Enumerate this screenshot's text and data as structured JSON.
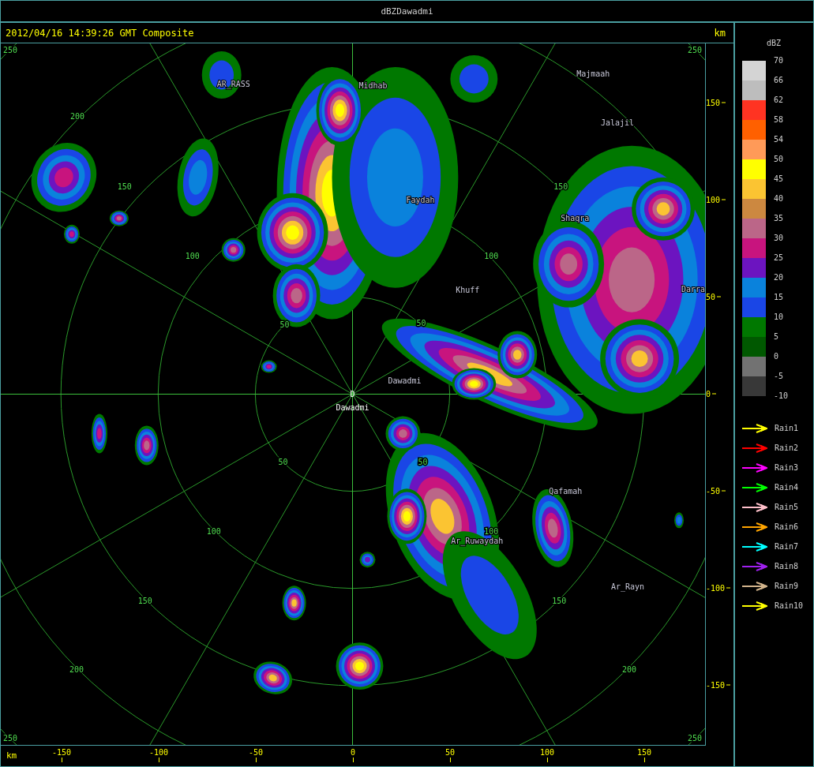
{
  "window": {
    "title": "dBZDawadmi"
  },
  "header": {
    "timestamp": "2012/04/16 14:39:26 GMT Composite",
    "unit": "km"
  },
  "map": {
    "site": {
      "marker": "D",
      "name": "Dawadmi"
    },
    "ring_labels": [
      "250",
      "250",
      "250",
      "250",
      "200",
      "150",
      "100",
      "50",
      "50",
      "100",
      "150",
      "50",
      "50",
      "100",
      "100",
      "150",
      "150",
      "200",
      "200"
    ],
    "places": [
      "AR_RASS",
      "Midhab",
      "Majmaah",
      "Jalajil",
      "Faydah",
      "Shaqra",
      "Khuff",
      "Darra",
      "Dawadmi",
      "Qafamah",
      "Ar_Ruwaydah",
      "Ar_Rayn"
    ]
  },
  "y_axis": {
    "ticks": [
      "150",
      "100",
      "50",
      "0",
      "-50",
      "-100",
      "-150"
    ]
  },
  "x_axis": {
    "unit": "km",
    "ticks": [
      "-150",
      "-100",
      "-50",
      "0",
      "50",
      "100",
      "150"
    ]
  },
  "legend": {
    "title": "dBZ",
    "labels": [
      "70",
      "66",
      "62",
      "58",
      "54",
      "50",
      "45",
      "40",
      "35",
      "30",
      "25",
      "20",
      "15",
      "10",
      "5",
      "0",
      "-5",
      "-10"
    ],
    "bands": [
      {
        "color": "#d4d4d4"
      },
      {
        "color": "#bdbdbd"
      },
      {
        "color": "#ff3322"
      },
      {
        "color": "#ff6000"
      },
      {
        "color": "#ff9a58"
      },
      {
        "color": "#ffff00"
      },
      {
        "color": "#fbc432"
      },
      {
        "color": "#cc8840"
      },
      {
        "color": "#bb6688"
      },
      {
        "color": "#c8147e"
      },
      {
        "color": "#6c14c0"
      },
      {
        "color": "#0a82dc"
      },
      {
        "color": "#1a46e6"
      },
      {
        "color": "#007800"
      },
      {
        "color": "#005800"
      },
      {
        "color": "#727272"
      },
      {
        "color": "#383838"
      }
    ]
  },
  "tracks": [
    {
      "label": "Rain1",
      "color": "#ffff00"
    },
    {
      "label": "Rain2",
      "color": "#ff0000"
    },
    {
      "label": "Rain3",
      "color": "#ff00ff"
    },
    {
      "label": "Rain4",
      "color": "#00ff00"
    },
    {
      "label": "Rain5",
      "color": "#ffc0cb"
    },
    {
      "label": "Rain6",
      "color": "#ffa500"
    },
    {
      "label": "Rain7",
      "color": "#00ffff"
    },
    {
      "label": "Rain8",
      "color": "#a020f0"
    },
    {
      "label": "Rain9",
      "color": "#d2b48c"
    },
    {
      "label": "Rain10",
      "color": "#ffff00"
    }
  ]
}
